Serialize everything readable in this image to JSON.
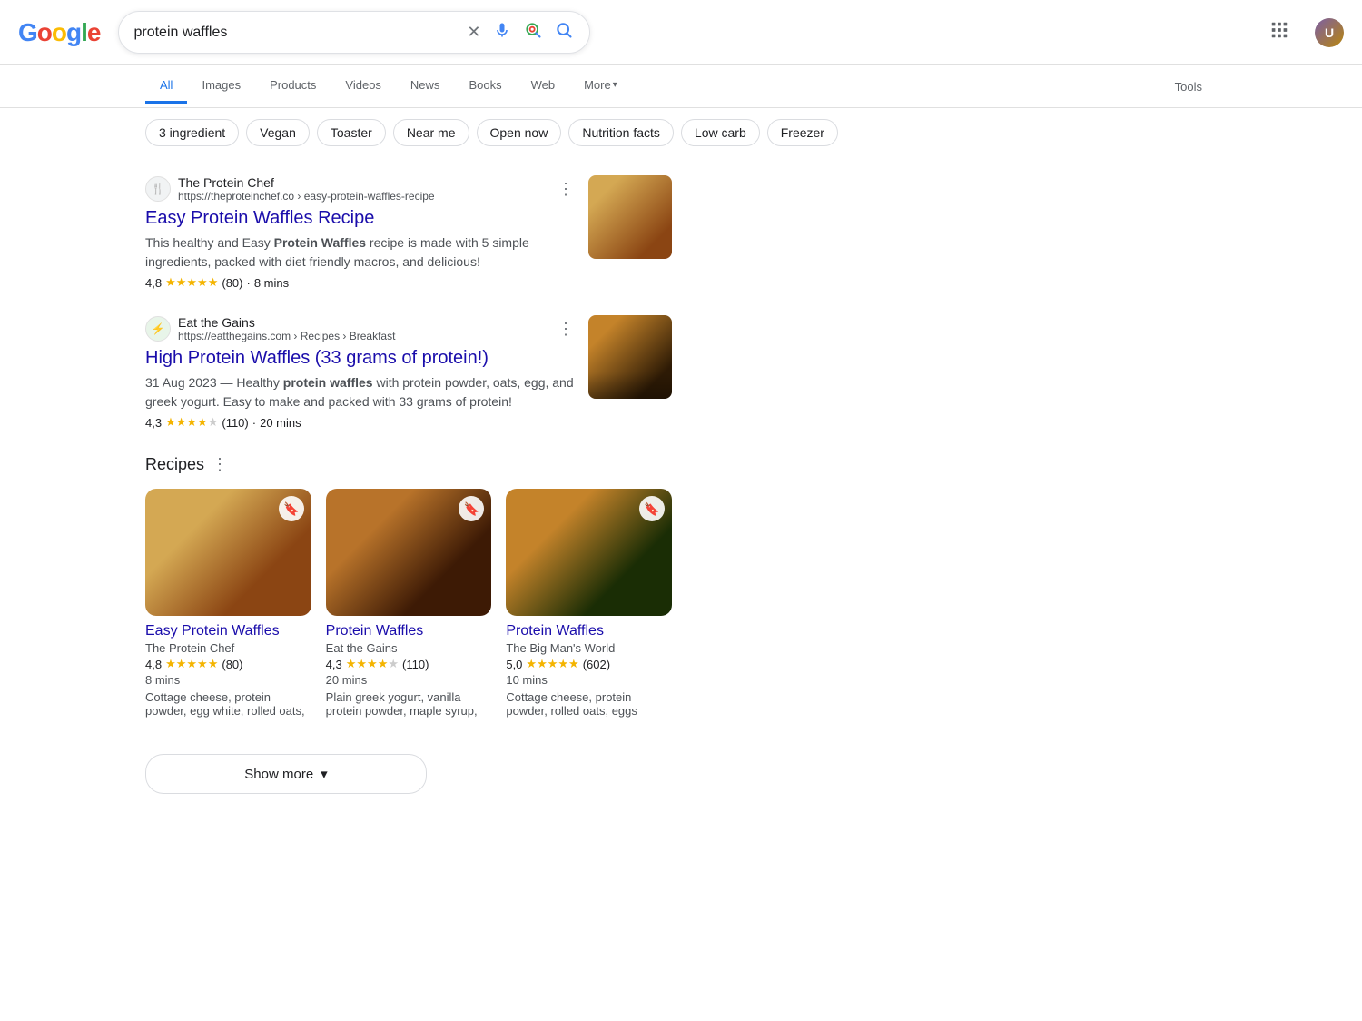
{
  "header": {
    "logo_text": "Google",
    "search_query": "protein waffles",
    "clear_label": "×",
    "voice_icon": "🎤",
    "lens_icon": "🔍",
    "search_icon": "🔍",
    "grid_icon": "⋮⋮⋮",
    "avatar_text": "U"
  },
  "nav": {
    "tabs": [
      {
        "label": "All",
        "active": true
      },
      {
        "label": "Images",
        "active": false
      },
      {
        "label": "Products",
        "active": false
      },
      {
        "label": "Videos",
        "active": false
      },
      {
        "label": "News",
        "active": false
      },
      {
        "label": "Books",
        "active": false
      },
      {
        "label": "Web",
        "active": false
      }
    ],
    "more_label": "More",
    "tools_label": "Tools"
  },
  "filters": [
    "3 ingredient",
    "Vegan",
    "Toaster",
    "Near me",
    "Open now",
    "Nutrition facts",
    "Low carb",
    "Freezer"
  ],
  "results": [
    {
      "source_name": "The Protein Chef",
      "source_url": "https://theproteinchef.co › easy-protein-waffles-recipe",
      "favicon_text": "🍴",
      "title": "Easy Protein Waffles Recipe",
      "description": "This healthy and Easy Protein Waffles recipe is made with 5 simple ingredients, packed with diet friendly macros, and delicious!",
      "bold_words": [
        "Protein Waffles"
      ],
      "rating_value": "4,8",
      "rating_stars": "★★★★★",
      "rating_count": "(80)",
      "time": "8 mins"
    },
    {
      "source_name": "Eat the Gains",
      "source_url": "https://eatthegains.com › Recipes › Breakfast",
      "favicon_text": "⚡",
      "title": "High Protein Waffles (33 grams of protein!)",
      "description": "31 Aug 2023 — Healthy protein waffles with protein powder, oats, egg, and greek yogurt. Easy to make and packed with 33 grams of protein!",
      "bold_words": [
        "protein waffles"
      ],
      "rating_value": "4,3",
      "rating_stars": "★★★★½",
      "rating_count": "(110)",
      "time": "20 mins"
    }
  ],
  "recipes_section": {
    "title": "Recipes",
    "items": [
      {
        "title": "Easy Protein Waffles",
        "source": "The Protein Chef",
        "rating": "4,8",
        "stars": "★★★★★",
        "count": "(80)",
        "time": "8 mins",
        "ingredients": "Cottage cheese, protein powder, egg white, rolled oats,"
      },
      {
        "title": "Protein Waffles",
        "source": "Eat the Gains",
        "rating": "4,3",
        "stars": "★★★★½",
        "count": "(110)",
        "time": "20 mins",
        "ingredients": "Plain greek yogurt, vanilla protein powder, maple syrup,"
      },
      {
        "title": "Protein Waffles",
        "source": "The Big Man's World",
        "rating": "5,0",
        "stars": "★★★★★",
        "count": "(602)",
        "time": "10 mins",
        "ingredients": "Cottage cheese, protein powder, rolled oats, eggs"
      }
    ]
  },
  "show_more": {
    "label": "Show more",
    "icon": "▾"
  }
}
